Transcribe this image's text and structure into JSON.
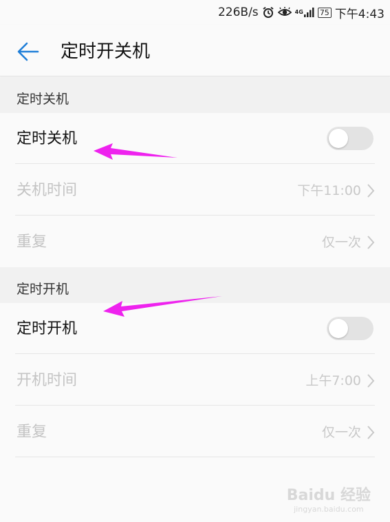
{
  "status_bar": {
    "speed": "226B/s",
    "net_type": "4G",
    "battery": "75",
    "time": "下午4:43"
  },
  "app_bar": {
    "title": "定时开关机"
  },
  "sections": [
    {
      "header": "定时关机",
      "toggle_label": "定时关机",
      "toggle_on": false,
      "time_label": "关机时间",
      "time_value": "下午11:00",
      "repeat_label": "重复",
      "repeat_value": "仅一次"
    },
    {
      "header": "定时开机",
      "toggle_label": "定时开机",
      "toggle_on": false,
      "time_label": "开机时间",
      "time_value": "上午7:00",
      "repeat_label": "重复",
      "repeat_value": "仅一次"
    }
  ],
  "colors": {
    "accent": "#1f7ed8",
    "annotation_arrow": "#ee22ee",
    "disabled_text": "#c4c4c4"
  },
  "watermark": {
    "logo": "Baidu 经验",
    "url": "jingyan.baidu.com"
  }
}
